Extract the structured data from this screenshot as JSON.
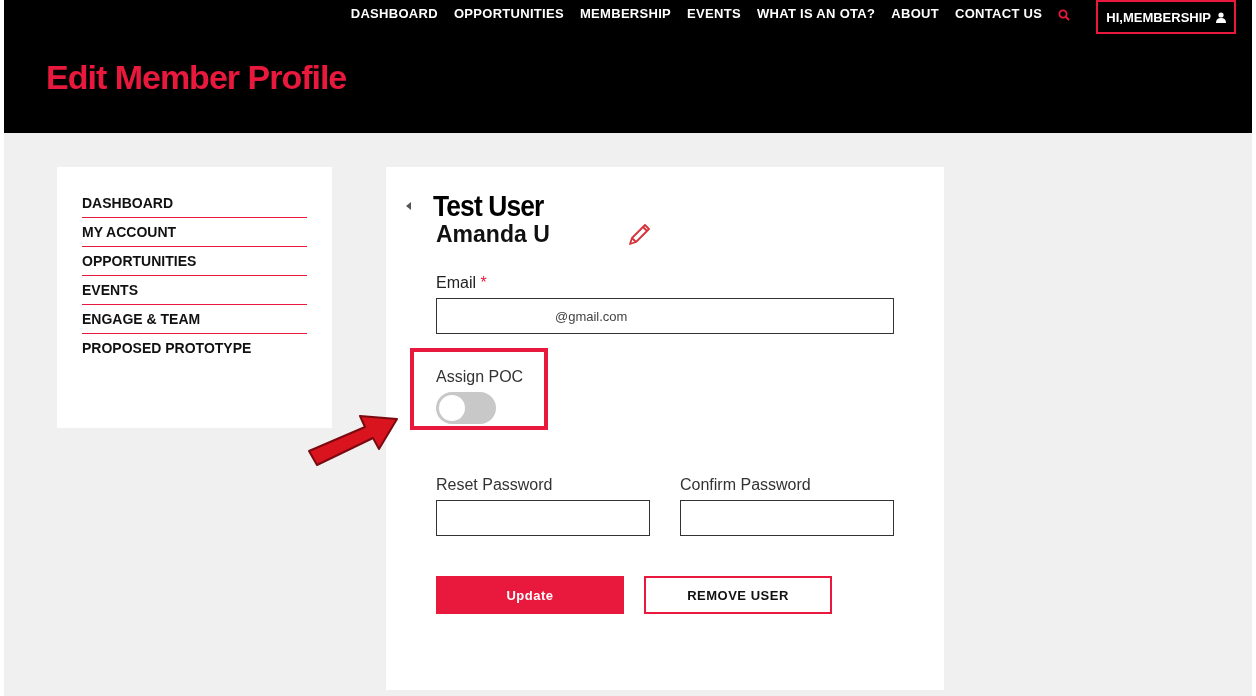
{
  "nav": {
    "items": [
      {
        "label": "DASHBOARD"
      },
      {
        "label": "OPPORTUNITIES"
      },
      {
        "label": "MEMBERSHIP"
      },
      {
        "label": "EVENTS"
      },
      {
        "label": "WHAT IS AN OTA?"
      },
      {
        "label": "ABOUT"
      },
      {
        "label": "CONTACT US"
      }
    ],
    "account": "HI,MEMBERSHIP"
  },
  "page_title": "Edit Member Profile",
  "sidebar": {
    "items": [
      {
        "label": "DASHBOARD"
      },
      {
        "label": "MY ACCOUNT"
      },
      {
        "label": "OPPORTUNITIES"
      },
      {
        "label": "EVENTS"
      },
      {
        "label": "ENGAGE & TEAM"
      },
      {
        "label": "PROPOSED PROTOTYPE"
      }
    ]
  },
  "profile": {
    "title": "Test User",
    "name": "Amanda U"
  },
  "form": {
    "email_label": "Email",
    "required_mark": "*",
    "email_value": "@gmail.com",
    "assign_poc": {
      "label": "Assign POC",
      "on": false
    },
    "reset_password_label": "Reset Password",
    "confirm_password_label": "Confirm Password"
  },
  "buttons": [
    {
      "label": "Update",
      "kind": "primary"
    },
    {
      "label": "REMOVE USER",
      "kind": "outline"
    }
  ]
}
